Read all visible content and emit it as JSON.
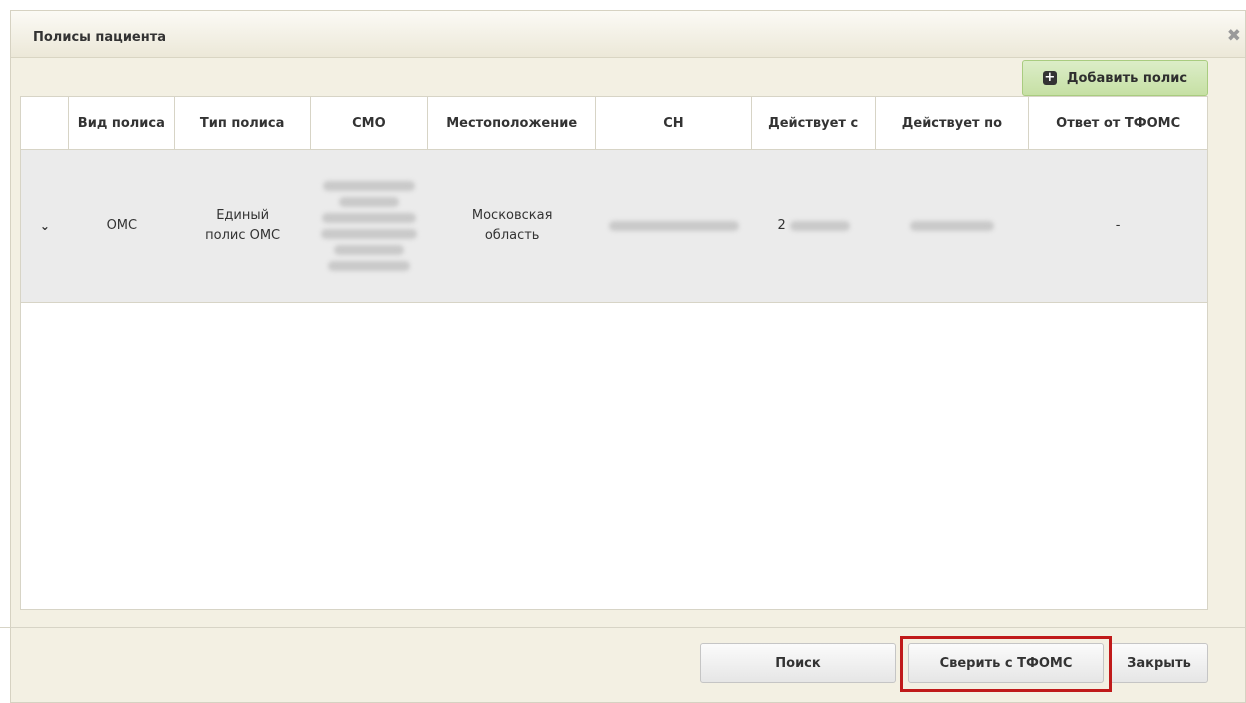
{
  "dialog": {
    "title": "Полисы пациента",
    "close_glyph": "✖"
  },
  "toolbar": {
    "add_button_label": "Добавить полис",
    "add_icon": "plus-square-icon"
  },
  "table": {
    "columns": [
      "",
      "Вид полиса",
      "Тип полиса",
      "СМО",
      "Местоположение",
      "СН",
      "Действует с",
      "Действует по",
      "Ответ от ТФОМС"
    ],
    "rows": [
      {
        "expand_icon": "chevron-down-icon",
        "vid_polisa": "ОМС",
        "tip_polisa": "Единый полис ОМС",
        "smo": "",
        "location": "Московская область",
        "sn": "",
        "valid_from": "2",
        "valid_to": "",
        "tfoms_response": "-"
      }
    ]
  },
  "footer": {
    "search_label": "Поиск",
    "verify_label": "Сверить с ТФОМС",
    "close_label": "Закрыть"
  },
  "colors": {
    "dialog_bg": "#f3f0e3",
    "add_button_bg": "#c6e0a4",
    "row_bg": "#ebebeb",
    "highlight": "#c01a1a"
  }
}
